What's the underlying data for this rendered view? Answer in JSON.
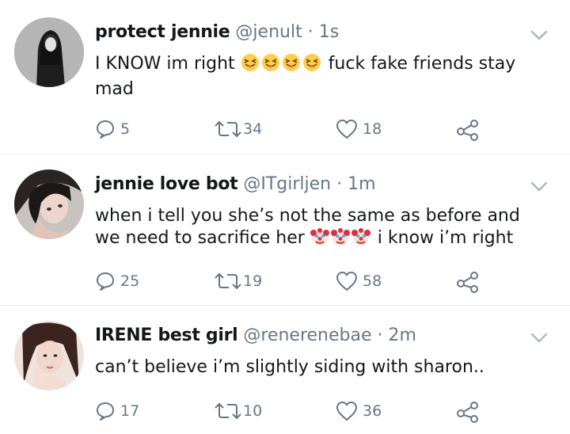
{
  "tweets": [
    {
      "name": "protect jennie",
      "handle": "@jenult",
      "separator": "·",
      "time": "1s",
      "text_before": "I KNOW im right",
      "emojis": [
        "squinting-face-with-tongue",
        "squinting-face-with-tongue",
        "squinting-face-with-tongue",
        "squinting-face-with-tongue"
      ],
      "text_after": "fuck fake friends stay mad",
      "replies": "5",
      "retweets": "34",
      "likes": "18"
    },
    {
      "name": "jennie love bot",
      "handle": "@ITgirljen",
      "separator": "·",
      "time": "1m",
      "text_before": "when i tell you she’s not the same as before and we need to sacrifice her",
      "emojis": [
        "clown-face",
        "clown-face",
        "clown-face"
      ],
      "text_after": "i know i’m right",
      "replies": "25",
      "retweets": "19",
      "likes": "58"
    },
    {
      "name": "IRENE best girl",
      "handle": "@renerenebae",
      "separator": "·",
      "time": "2m",
      "text_before": "can’t believe i’m slightly siding with sharon..",
      "emojis": [],
      "text_after": "",
      "replies": "17",
      "retweets": "10",
      "likes": "36"
    }
  ],
  "colors": {
    "text": "#14171a",
    "muted": "#657786",
    "divider": "#e6ecf0",
    "emoji_yellow": "#ffcc4d"
  }
}
